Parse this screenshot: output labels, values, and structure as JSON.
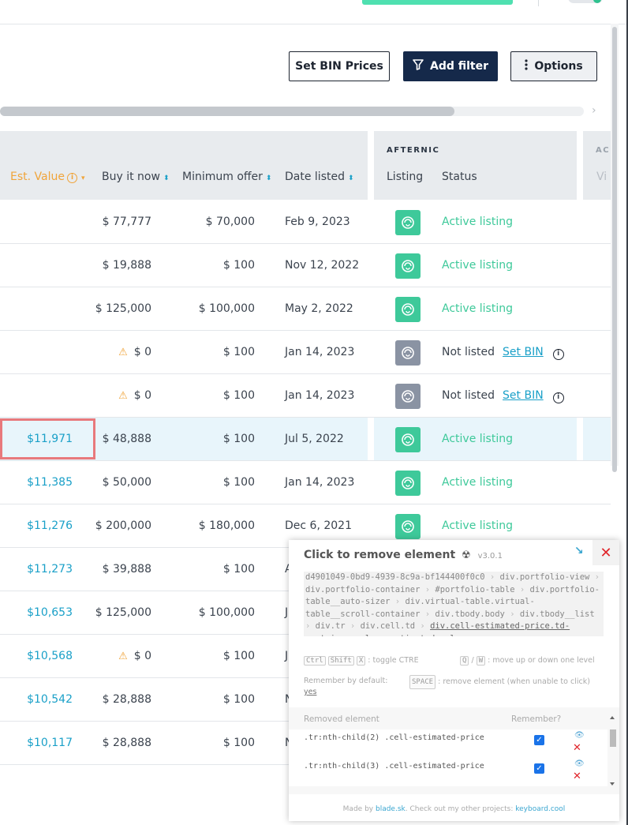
{
  "toolbar": {
    "set_bin_prices": "Set BIN Prices",
    "add_filter": "Add filter",
    "options": "Options"
  },
  "columns": {
    "est_value": "Est. Value",
    "buy_it_now": "Buy it now",
    "minimum_offer": "Minimum offer",
    "date_listed": "Date listed",
    "afternic_group": "AFTERNIC",
    "listing": "Listing",
    "status": "Status",
    "next_group_partial": "AC",
    "next_col_partial": "Vi"
  },
  "rows": [
    {
      "est": "",
      "buy": "$ 77,777",
      "min": "$ 70,000",
      "date": "Feb 9, 2023",
      "status": "Active listing",
      "listed": true
    },
    {
      "est": "",
      "buy": "$ 19,888",
      "min": "$ 100",
      "date": "Nov 12, 2022",
      "status": "Active listing",
      "listed": true
    },
    {
      "est": "",
      "buy": "$ 125,000",
      "min": "$ 100,000",
      "date": "May 2, 2022",
      "status": "Active listing",
      "listed": true
    },
    {
      "est": "",
      "buy": "$ 0",
      "min": "$ 100",
      "date": "Jan 14, 2023",
      "status": "Not listed",
      "set_bin": "Set BIN",
      "listed": false,
      "warn": true
    },
    {
      "est": "",
      "buy": "$ 0",
      "min": "$ 100",
      "date": "Jan 14, 2023",
      "status": "Not listed",
      "set_bin": "Set BIN",
      "listed": false,
      "warn": true
    },
    {
      "est": "$11,971",
      "buy": "$ 48,888",
      "min": "$ 100",
      "date": "Jul 5, 2022",
      "status": "Active listing",
      "listed": true
    },
    {
      "est": "$11,385",
      "buy": "$ 50,000",
      "min": "$ 100",
      "date": "Jan 14, 2023",
      "status": "Active listing",
      "listed": true
    },
    {
      "est": "$11,276",
      "buy": "$ 200,000",
      "min": "$ 180,000",
      "date": "Dec 6, 2021",
      "status": "Active listing",
      "listed": true
    },
    {
      "est": "$11,273",
      "buy": "$ 39,888",
      "min": "$ 100",
      "date": "A",
      "status": "",
      "listed": null
    },
    {
      "est": "$10,653",
      "buy": "$ 125,000",
      "min": "$ 100,000",
      "date": "J",
      "status": "",
      "listed": null
    },
    {
      "est": "$10,568",
      "buy": "$ 0",
      "min": "$ 100",
      "date": "J",
      "status": "",
      "listed": null,
      "warn": true
    },
    {
      "est": "$10,542",
      "buy": "$ 28,888",
      "min": "$ 100",
      "date": "N",
      "status": "",
      "listed": null
    },
    {
      "est": "$10,117",
      "buy": "$ 28,888",
      "min": "$ 100",
      "date": "N",
      "status": "",
      "listed": null
    }
  ],
  "ctre": {
    "title": "Click to remove element",
    "version": "v3.0.1",
    "path_segments": [
      "d4901049-0bd9-4939-8c9a-bf144400f0c0",
      "div.portfolio-view",
      "div.portfolio-container",
      "#portfolio-table",
      "div.portfolio-table__auto-sizer",
      "div.virtual-table.virtual-table__scroll-container",
      "div.tbody.body",
      "div.tbody__list",
      "div.tr",
      "div.cell.td",
      "div.cell-estimated-price.td-container.column-estimated_value"
    ],
    "help_toggle": ": toggle CTRE",
    "help_move": ": move up or down one level",
    "remember_label": "Remember by default:",
    "remember_value": "yes",
    "help_remove": ": remove element (when unable to click)",
    "keys": {
      "ctrl": "Ctrl",
      "shift": "Shift",
      "x": "X",
      "q": "Q",
      "w": "W",
      "space": "SPACE",
      "slash": "/"
    },
    "table_head_removed": "Removed element",
    "table_head_remember": "Remember?",
    "removed": [
      {
        "selector": ".tr:nth-child(2) .cell-estimated-price"
      },
      {
        "selector": ".tr:nth-child(3) .cell-estimated-price"
      }
    ],
    "footer_made_by": "Made by",
    "footer_author": "blade.sk",
    "footer_mid": ". Check out my other projects:",
    "footer_link": "keyboard.cool"
  },
  "colors": {
    "accent_teal": "#1aa0c8",
    "active_green": "#3ec99a",
    "warn_orange": "#f0a43a",
    "navy": "#15294a",
    "highlight_red": "#e8797c"
  }
}
